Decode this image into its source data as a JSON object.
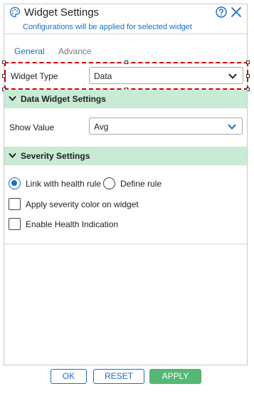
{
  "header": {
    "title": "Widget Settings",
    "subtitle": "Configurations will be applied for selected widget",
    "icons": {
      "left": "palette-icon",
      "help": "help-circle-icon",
      "close": "close-icon"
    }
  },
  "tabs": [
    {
      "label": "General",
      "active": true
    },
    {
      "label": "Advance",
      "active": false
    }
  ],
  "widget_type": {
    "label": "Widget Type",
    "value": "Data"
  },
  "data_widget_section": {
    "title": "Data Widget Settings",
    "show_value": {
      "label": "Show Value",
      "value": "Avg"
    }
  },
  "severity_section": {
    "title": "Severity Settings",
    "radio_link": {
      "label": "Link with health rule",
      "checked": true
    },
    "radio_define": {
      "label": "Define rule",
      "checked": false
    },
    "checkbox_apply_color": {
      "label": "Apply severity color on widget",
      "checked": false
    },
    "checkbox_health": {
      "label": "Enable Health Indication",
      "checked": false
    }
  },
  "footer": {
    "ok_label": "OK",
    "reset_label": "RESET",
    "apply_label": "APPLY"
  },
  "colors": {
    "accent": "#1a6fc4",
    "section_bg": "#c8ebd3",
    "apply_bg": "#55b874",
    "highlight_border": "#d40000"
  }
}
